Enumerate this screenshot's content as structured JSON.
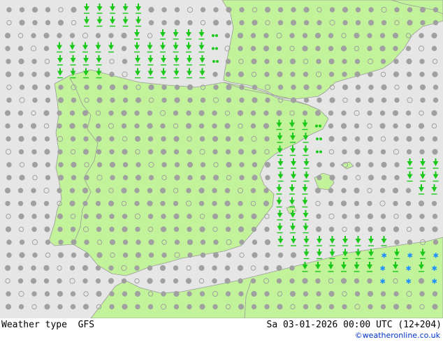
{
  "map": {
    "colors": {
      "sea": "#e6e6e6",
      "land": "#c2f29a",
      "border": "#9a9a9a",
      "symbol_gray": "#a0a0a0",
      "symbol_green": "#19c819",
      "symbol_blue": "#1e90ff"
    },
    "legend": "Weather type symbols: gray dots (cloud cover), green arrows/dots (rain/drizzle), blue stars (snow)"
  },
  "footer": {
    "left_label": "Weather type",
    "model": "GFS",
    "datetime": "Sa 03-01-2026 00:00 UTC (12+204)",
    "credit": "©weatheronline.co.uk"
  }
}
